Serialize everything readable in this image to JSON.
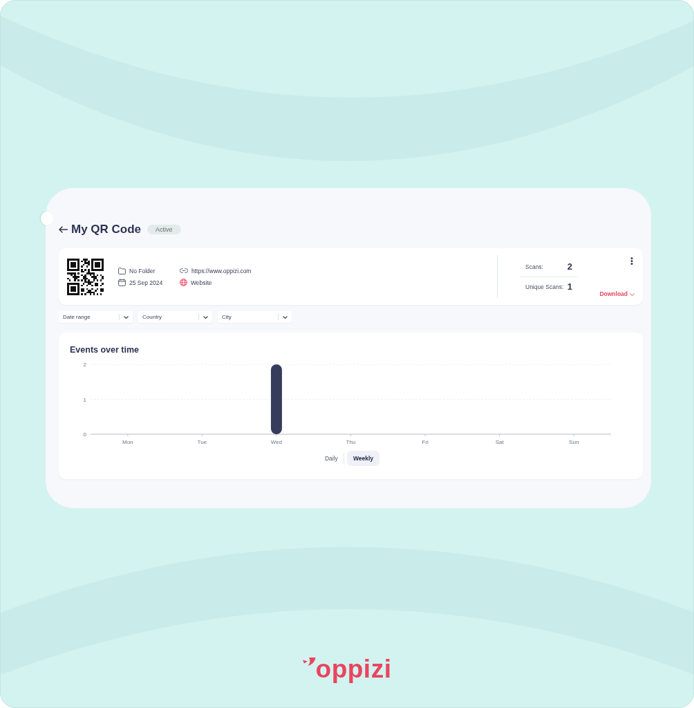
{
  "header": {
    "title": "My QR Code",
    "status": "Active"
  },
  "qr_card": {
    "detail_columns": [
      {
        "items": [
          {
            "kind": "folder",
            "text": "No Folder"
          },
          {
            "kind": "date",
            "text": "25 Sep 2024"
          }
        ]
      },
      {
        "items": [
          {
            "kind": "link",
            "text": "https://www.oppizi.com"
          },
          {
            "kind": "website",
            "text": "Website"
          }
        ]
      }
    ],
    "stats": [
      {
        "label": "Scans:",
        "value": "2"
      },
      {
        "label": "Unique Scans:",
        "value": "1"
      }
    ],
    "download": "Download"
  },
  "filters": [
    {
      "placeholder": "Date range"
    },
    {
      "placeholder": "Country"
    },
    {
      "placeholder": "City"
    }
  ],
  "events_chart": {
    "title": "Events over time",
    "chart_data": {
      "type": "bar",
      "categories": [
        "Mon",
        "Tue",
        "Wed",
        "Thu",
        "Fri",
        "Sat",
        "Sun"
      ],
      "values": [
        0,
        0,
        2,
        0,
        0,
        0,
        0
      ],
      "ylim": [
        0,
        2
      ],
      "yticks": [
        0,
        1,
        2
      ]
    },
    "period_tabs": [
      {
        "label": "Daily",
        "selected": false
      },
      {
        "label": "Weekly",
        "selected": true
      }
    ]
  },
  "brand": {
    "wordmark": "oppizi"
  }
}
